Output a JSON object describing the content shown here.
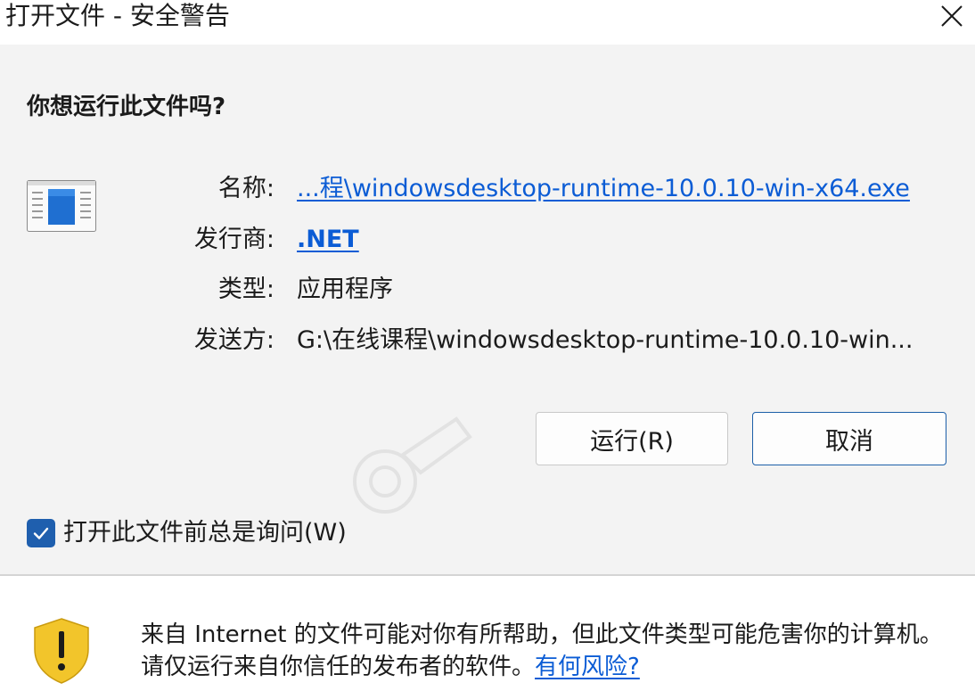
{
  "window": {
    "title": "打开文件 - 安全警告",
    "close_glyph": "✕"
  },
  "dialog": {
    "question": "你想运行此文件吗?",
    "fields": {
      "name_label": "名称:",
      "name_value": "...程\\windowsdesktop-runtime-10.0.10-win-x64.exe",
      "publisher_label": "发行商:",
      "publisher_value": ".NET",
      "type_label": "类型:",
      "type_value": "应用程序",
      "from_label": "发送方:",
      "from_value": "G:\\在线课程\\windowsdesktop-runtime-10.0.10-win..."
    },
    "buttons": {
      "run_label": "运行(R)",
      "cancel_label": "取消"
    },
    "checkbox": {
      "label": "打开此文件前总是询问(W)",
      "checked": true
    }
  },
  "footer": {
    "warning_text": "来自 Internet 的文件可能对你有所帮助，但此文件类型可能危害你的计算机。请仅运行来自你信任的发布者的软件。",
    "risk_link": "有何风险?"
  },
  "colors": {
    "link": "#0b5cd5",
    "accent": "#1f5fae",
    "shield": "#f2c52b",
    "content_bg": "#f3f3f3"
  },
  "icons": [
    "close-icon",
    "application-file-icon",
    "checkmark-icon",
    "warning-shield-icon"
  ]
}
